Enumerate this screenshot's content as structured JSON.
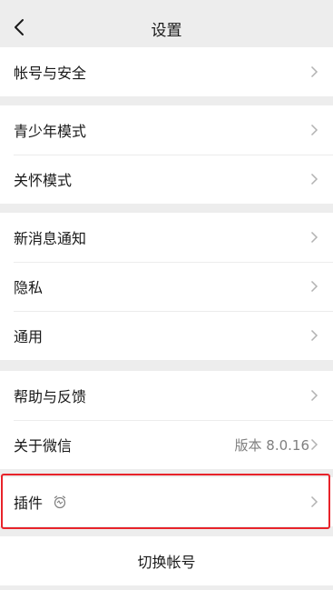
{
  "nav": {
    "title": "设置",
    "back_icon": "chevron-left-icon"
  },
  "groups": [
    {
      "items": [
        {
          "label": "帐号与安全"
        }
      ]
    },
    {
      "items": [
        {
          "label": "青少年模式"
        },
        {
          "label": "关怀模式"
        }
      ]
    },
    {
      "items": [
        {
          "label": "新消息通知"
        },
        {
          "label": "隐私"
        },
        {
          "label": "通用"
        }
      ]
    },
    {
      "items": [
        {
          "label": "帮助与反馈"
        },
        {
          "label": "关于微信",
          "value": "版本 8.0.16"
        }
      ]
    },
    {
      "items": [
        {
          "label": "插件",
          "icon": "plugin-clock-icon"
        }
      ]
    }
  ],
  "switch_account": {
    "label": "切换帐号"
  },
  "colors": {
    "highlight": "#e8232a",
    "background": "#ededed",
    "text": "#191919",
    "secondary": "#7f7f7f"
  }
}
